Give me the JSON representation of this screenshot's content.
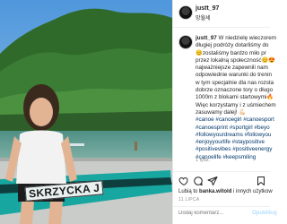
{
  "post": {
    "username": "justt_97",
    "location": "망월세",
    "caption": {
      "lines": [
        " W niedzielę wieczorem",
        "długiej podróży dotarliśmy do",
        "😊zostaliśmy bardzo miło pr",
        "przez lokalną społeczność😊😍",
        "najważniejsze zapewnili nam",
        "odpowiednie warunki do trenin",
        "w tym specjalnie dla nas rozsta",
        "dobrze oznaczone tory o długo",
        "1000m z blokami startowymi🔥",
        "Więc korzystamy i z uśmiechem",
        "zasuwamy dalej! 💪🏻",
        "#canoe #canoegirl #canoesport",
        "#canoesprint #sportgirl #beyo",
        "#followyourdreams #followyou",
        "#enjoyyourlife #staypositive",
        "#positivevibes #positiveenergy",
        "#canoelife #keepsmiling"
      ],
      "hashtag_line_start": 11
    },
    "time_ago": "1 tydz.",
    "likes_prefix": "Lubią to ",
    "likes_user": "banka.witold",
    "likes_suffix": " i innych użytkow",
    "date": "11 LIPCA",
    "comment_placeholder": "Dodaj komentarz...",
    "post_button": "Opublikuj",
    "kayak_label": "SKRZYCKA J"
  },
  "icons": {
    "like": "heart-icon",
    "comment": "comment-icon",
    "share": "share-icon",
    "save": "bookmark-icon"
  }
}
